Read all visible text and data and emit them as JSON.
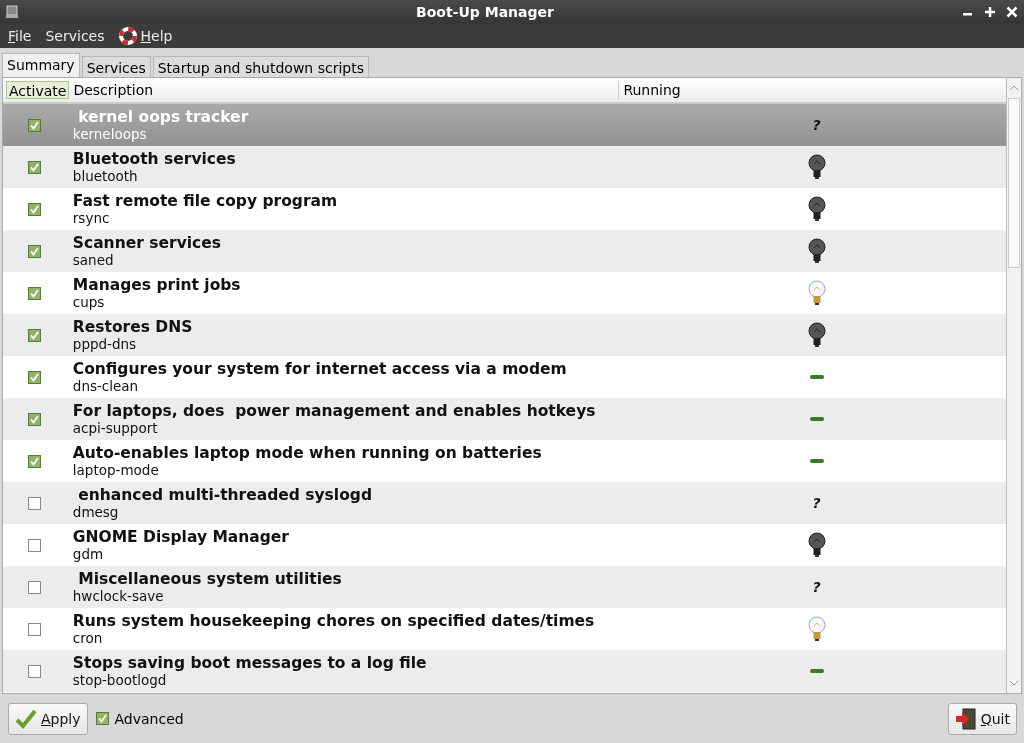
{
  "window": {
    "title": "Boot-Up Manager"
  },
  "menu": [
    {
      "label": "File",
      "underline_first": true,
      "icon": false
    },
    {
      "label": "Services",
      "underline_first": false,
      "icon": false
    },
    {
      "label": "Help",
      "underline_first": true,
      "icon": true
    }
  ],
  "tabs": [
    {
      "label": "Summary",
      "selected": true
    },
    {
      "label": "Services",
      "selected": false
    },
    {
      "label": "Startup and shutdown scripts",
      "selected": false
    }
  ],
  "table": {
    "columns": [
      "Activate",
      "Description",
      "Running"
    ],
    "rows": [
      {
        "title": " kernel oops tracker",
        "name": "kerneloops",
        "checked": true,
        "selected": true,
        "running": {
          "kind": "unknown",
          "symbol": "?"
        }
      },
      {
        "title": "Bluetooth services",
        "name": "bluetooth",
        "checked": true,
        "selected": false,
        "running": {
          "kind": "off"
        }
      },
      {
        "title": "Fast remote file copy program",
        "name": "rsync",
        "checked": true,
        "selected": false,
        "running": {
          "kind": "off"
        }
      },
      {
        "title": "Scanner services",
        "name": "saned",
        "checked": true,
        "selected": false,
        "running": {
          "kind": "off"
        }
      },
      {
        "title": "Manages print jobs",
        "name": "cups",
        "checked": true,
        "selected": false,
        "running": {
          "kind": "on"
        }
      },
      {
        "title": "Restores DNS",
        "name": "pppd-dns",
        "checked": true,
        "selected": false,
        "running": {
          "kind": "off"
        }
      },
      {
        "title": "Configures your system for internet access via a modem",
        "name": "dns-clean",
        "checked": true,
        "selected": false,
        "running": {
          "kind": "none"
        }
      },
      {
        "title": "For laptops, does  power management and enables hotkeys",
        "name": "acpi-support",
        "checked": true,
        "selected": false,
        "running": {
          "kind": "none"
        }
      },
      {
        "title": "Auto-enables laptop mode when running on batteries",
        "name": "laptop-mode",
        "checked": true,
        "selected": false,
        "running": {
          "kind": "none"
        }
      },
      {
        "title": " enhanced multi-threaded syslogd",
        "name": "dmesg",
        "checked": false,
        "selected": false,
        "running": {
          "kind": "unknown",
          "symbol": "?"
        }
      },
      {
        "title": "GNOME Display Manager",
        "name": "gdm",
        "checked": false,
        "selected": false,
        "running": {
          "kind": "off"
        }
      },
      {
        "title": " Miscellaneous system utilities",
        "name": "hwclock-save",
        "checked": false,
        "selected": false,
        "running": {
          "kind": "unknown",
          "symbol": "?"
        }
      },
      {
        "title": "Runs system housekeeping chores on specified dates/times",
        "name": "cron",
        "checked": false,
        "selected": false,
        "running": {
          "kind": "on"
        }
      },
      {
        "title": "Stops saving boot messages to a log file",
        "name": "stop-bootlogd",
        "checked": false,
        "selected": false,
        "running": {
          "kind": "none"
        }
      }
    ]
  },
  "footer": {
    "apply": {
      "label": "Apply",
      "underline_first": true
    },
    "advanced": {
      "label": "Advanced",
      "checked": true
    },
    "quit": {
      "label": "Quit",
      "underline_first": true
    }
  }
}
